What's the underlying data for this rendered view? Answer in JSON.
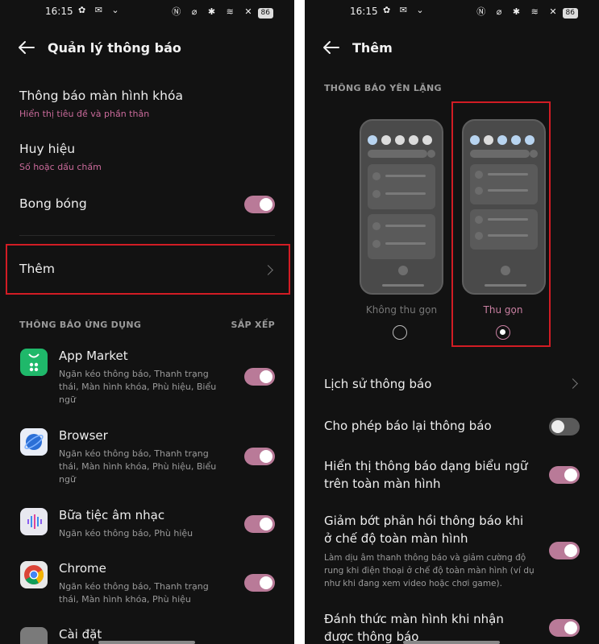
{
  "left": {
    "status": {
      "time": "16:15",
      "battery": "86"
    },
    "title": "Quản lý thông báo",
    "lock_screen": {
      "title": "Thông báo màn hình khóa",
      "subtitle": "Hiển thị tiêu đề và phần thân"
    },
    "badge": {
      "title": "Huy hiệu",
      "subtitle": "Số hoặc dấu chấm"
    },
    "bubble": {
      "title": "Bong bóng",
      "on": true
    },
    "more": {
      "title": "Thêm"
    },
    "section": {
      "title": "THÔNG BÁO ỨNG DỤNG",
      "action": "SẮP XẾP"
    },
    "apps": [
      {
        "name": "App Market",
        "desc": "Ngăn kéo thông báo, Thanh trạng thái, Màn hình khóa, Phù hiệu, Biểu ngữ",
        "icon": "app-market-icon",
        "color": "#1fb86a",
        "on": true
      },
      {
        "name": "Browser",
        "desc": "Ngăn kéo thông báo, Thanh trạng thái, Màn hình khóa, Phù hiệu, Biểu ngữ",
        "icon": "browser-icon",
        "color": "#2b6fd6",
        "on": true
      },
      {
        "name": "Bữa tiệc âm nhạc",
        "desc": "Ngăn kéo thông báo, Phù hiệu",
        "icon": "music-party-icon",
        "color": "#e8e8f0",
        "on": true
      },
      {
        "name": "Chrome",
        "desc": "Ngăn kéo thông báo, Thanh trạng thái, Màn hình khóa, Phù hiệu",
        "icon": "chrome-icon",
        "color": "#e8e8e8",
        "on": true
      },
      {
        "name": "Cài đặt",
        "desc": "",
        "icon": "settings-icon",
        "color": "#7a7a7a",
        "on": true
      }
    ]
  },
  "right": {
    "status": {
      "time": "16:15",
      "battery": "86"
    },
    "title": "Thêm",
    "section": {
      "title": "THÔNG BÁO YÊN LẶNG"
    },
    "options": [
      {
        "label": "Không thu gọn",
        "selected": false
      },
      {
        "label": "Thu gọn",
        "selected": true
      }
    ],
    "settings": [
      {
        "title": "Lịch sử thông báo",
        "type": "link"
      },
      {
        "title": "Cho phép báo lại thông báo",
        "type": "toggle",
        "on": false
      },
      {
        "title": "Hiển thị thông báo dạng biểu ngữ trên toàn màn hình",
        "type": "toggle",
        "on": true
      },
      {
        "title": "Giảm bớt phản hồi thông báo khi ở chế độ toàn màn hình",
        "desc": "Làm dịu âm thanh thông báo và giảm cường độ rung khi điện thoại ở chế độ toàn màn hình (ví dụ như khi đang xem video hoặc chơi game).",
        "type": "toggle",
        "on": true
      },
      {
        "title": "Đánh thức màn hình khi nhận được thông báo",
        "type": "toggle",
        "on": true
      }
    ]
  },
  "colors": {
    "background": "#121212",
    "accent": "#b97a98",
    "subtitle": "#c96a9a",
    "highlight": "#d21c24"
  }
}
